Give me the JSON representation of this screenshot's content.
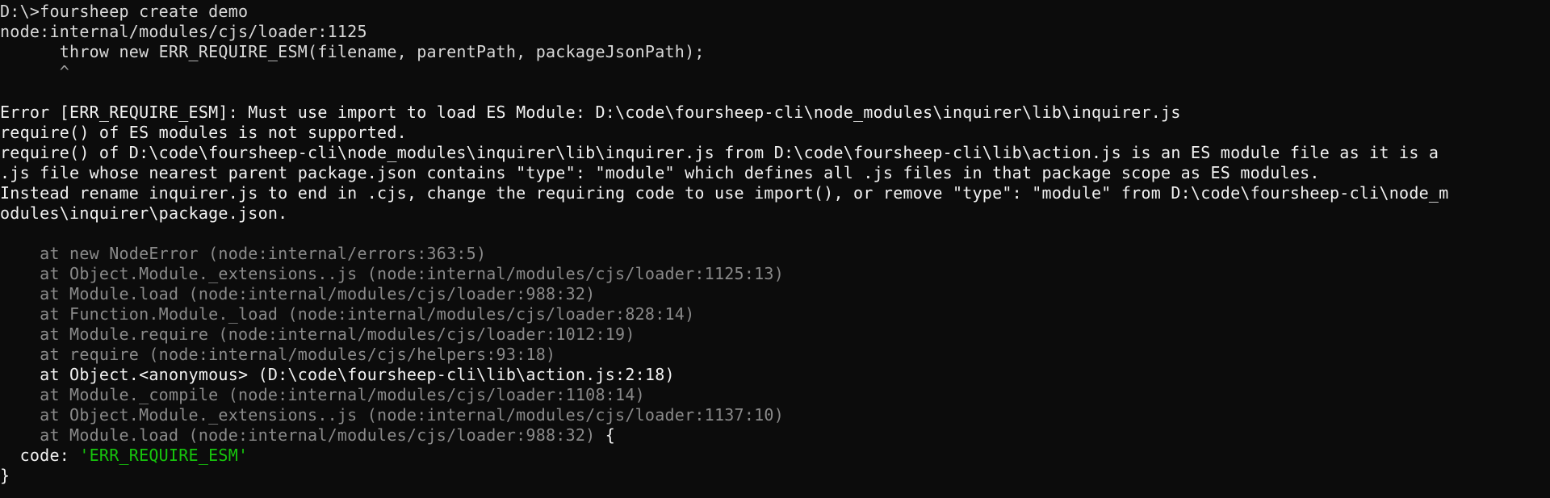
{
  "colors": {
    "background": "#0c0c0c",
    "text": "#cccccc",
    "stack_dim": "#8a8a8a",
    "string_green": "#16c60c"
  },
  "terminal": {
    "prompt": "D:\\>",
    "command": "foursheep create demo",
    "loader_ref": "node:internal/modules/cjs/loader:1125",
    "throw_line": "      throw new ERR_REQUIRE_ESM(filename, parentPath, packageJsonPath);",
    "caret_line": "      ^",
    "error_lines": [
      "Error [ERR_REQUIRE_ESM]: Must use import to load ES Module: D:\\code\\foursheep-cli\\node_modules\\inquirer\\lib\\inquirer.js",
      "require() of ES modules is not supported.",
      "require() of D:\\code\\foursheep-cli\\node_modules\\inquirer\\lib\\inquirer.js from D:\\code\\foursheep-cli\\lib\\action.js is an ES module file as it is a",
      ".js file whose nearest parent package.json contains \"type\": \"module\" which defines all .js files in that package scope as ES modules.",
      "Instead rename inquirer.js to end in .cjs, change the requiring code to use import(), or remove \"type\": \"module\" from D:\\code\\foursheep-cli\\node_m",
      "odules\\inquirer\\package.json."
    ],
    "stack": [
      {
        "text": "    at new NodeError (node:internal/errors:363:5)",
        "style": "dim"
      },
      {
        "text": "    at Object.Module._extensions..js (node:internal/modules/cjs/loader:1125:13)",
        "style": "dim"
      },
      {
        "text": "    at Module.load (node:internal/modules/cjs/loader:988:32)",
        "style": "dim"
      },
      {
        "text": "    at Function.Module._load (node:internal/modules/cjs/loader:828:14)",
        "style": "dim"
      },
      {
        "text": "    at Module.require (node:internal/modules/cjs/loader:1012:19)",
        "style": "dim"
      },
      {
        "text": "    at require (node:internal/modules/cjs/helpers:93:18)",
        "style": "dim"
      },
      {
        "text": "    at Object.<anonymous> (D:\\code\\foursheep-cli\\lib\\action.js:2:18)",
        "style": "bright"
      },
      {
        "text": "    at Module._compile (node:internal/modules/cjs/loader:1108:14)",
        "style": "dim"
      },
      {
        "text": "    at Object.Module._extensions..js (node:internal/modules/cjs/loader:1137:10)",
        "style": "dim"
      }
    ],
    "last_stack_line": "    at Module.load (node:internal/modules/cjs/loader:988:32)",
    "open_brace": " {",
    "code_key": "  code: ",
    "code_value": "'ERR_REQUIRE_ESM'",
    "close_brace": "}"
  }
}
